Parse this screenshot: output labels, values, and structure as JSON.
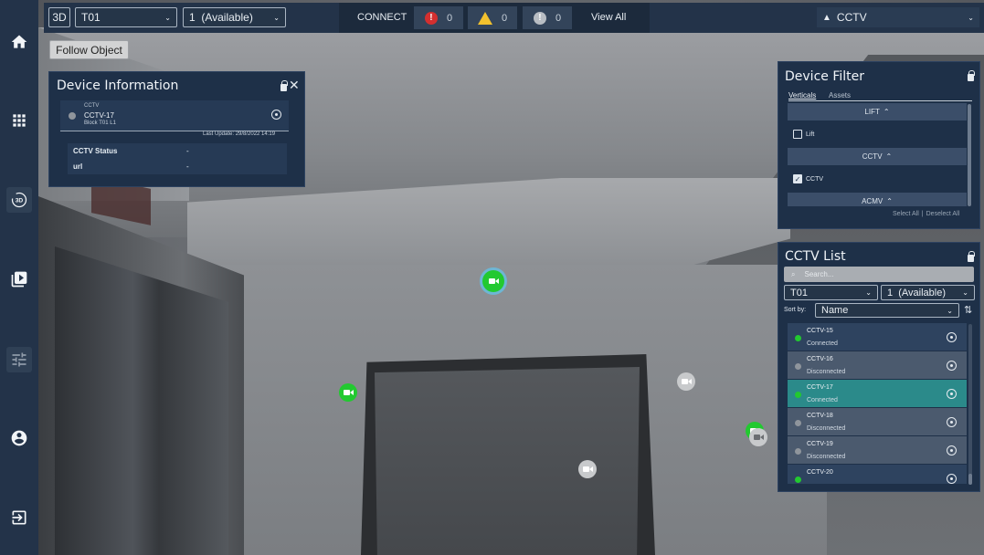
{
  "colors": {
    "sidebar": "#233349",
    "panel": "#1e3048",
    "connected": "#22c930",
    "disconnected": "#8f959c",
    "selected_row": "#2b8a8a"
  },
  "sidebar": {
    "items": [
      {
        "icon": "home-icon"
      },
      {
        "icon": "grid-icon"
      },
      {
        "icon": "3d-rotate-icon",
        "label": "3D"
      },
      {
        "icon": "playlist-play-icon"
      },
      {
        "icon": "sliders-icon"
      },
      {
        "icon": "account-icon"
      },
      {
        "icon": "logout-icon"
      }
    ]
  },
  "topbar": {
    "mode": "3D",
    "block_select": "T01",
    "level_select": "1  (Available)",
    "connect_label": "CONNECT",
    "alarm_count": "0",
    "warning_count": "0",
    "info_count": "0",
    "view_all_label": "View All",
    "category_select": "CCTV"
  },
  "follow_object_label": "Follow Object",
  "device_info": {
    "title": "Device Information",
    "category": "CCTV",
    "name": "CCTV-17",
    "location": "Block T01 L1",
    "last_update": "Last Update: 29/8/2022 14:19",
    "rows": [
      {
        "key": "CCTV Status",
        "value": "-"
      },
      {
        "key": "url",
        "value": "-"
      }
    ]
  },
  "device_filter": {
    "title": "Device Filter",
    "tabs": [
      "Verticals",
      "Assets"
    ],
    "groups": [
      {
        "header": "LIFT",
        "item": "Lift",
        "checked": false
      },
      {
        "header": "CCTV",
        "item": "CCTV",
        "checked": true
      },
      {
        "header": "ACMV"
      }
    ],
    "select_all": "Select All",
    "separator": "|",
    "deselect_all": "Deselect All"
  },
  "cctv_list": {
    "title": "CCTV List",
    "search_placeholder": "Search...",
    "block_select": "T01",
    "level_select": "1  (Available)",
    "sort_label": "Sort by:",
    "sort_select": "Name",
    "items": [
      {
        "name": "CCTV-15",
        "status": "Connected",
        "state": "on"
      },
      {
        "name": "CCTV-16",
        "status": "Disconnected",
        "state": "off"
      },
      {
        "name": "CCTV-17",
        "status": "Connected",
        "state": "sel"
      },
      {
        "name": "CCTV-18",
        "status": "Disconnected",
        "state": "off"
      },
      {
        "name": "CCTV-19",
        "status": "Disconnected",
        "state": "off"
      },
      {
        "name": "CCTV-20",
        "status": "",
        "state": "on"
      }
    ]
  }
}
